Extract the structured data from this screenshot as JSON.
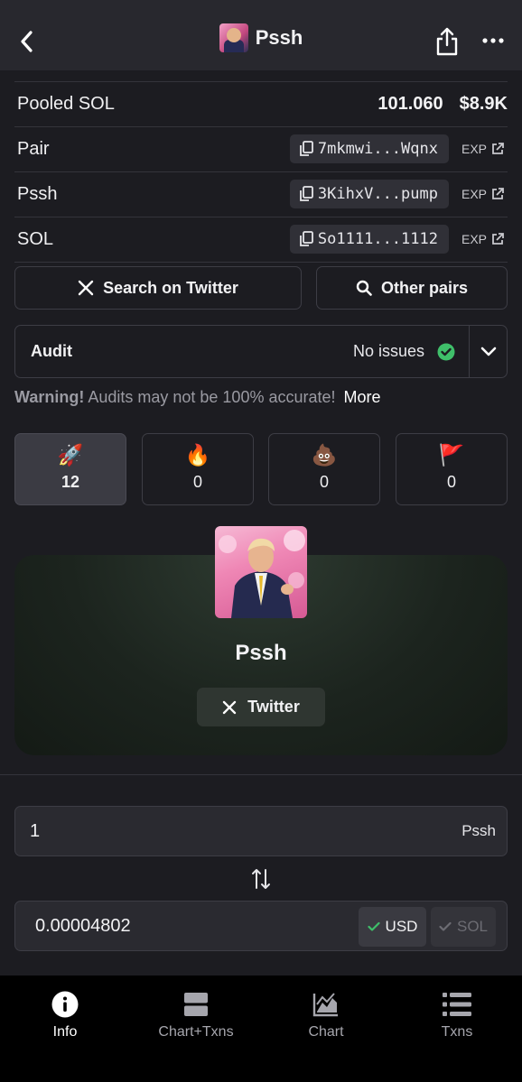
{
  "header": {
    "title": "Pssh"
  },
  "pooled": {
    "label": "Pooled SOL",
    "amount": "101.060",
    "usd": "$8.9K"
  },
  "rows": [
    {
      "label": "Pair",
      "address": "7mkmwi...Wqnx",
      "exp": "EXP"
    },
    {
      "label": "Pssh",
      "address": "3KihxV...pump",
      "exp": "EXP"
    },
    {
      "label": "SOL",
      "address": "So1111...1112",
      "exp": "EXP"
    }
  ],
  "actions": {
    "twitter_search": "Search on Twitter",
    "other_pairs": "Other pairs"
  },
  "audit": {
    "label": "Audit",
    "status": "No issues"
  },
  "warning": {
    "prefix": "Warning!",
    "text": " Audits may not be 100% accurate!",
    "more": "More"
  },
  "reactions": [
    {
      "emoji": "🚀",
      "count": "12"
    },
    {
      "emoji": "🔥",
      "count": "0"
    },
    {
      "emoji": "💩",
      "count": "0"
    },
    {
      "emoji": "🚩",
      "count": "0"
    }
  ],
  "token": {
    "name": "Pssh",
    "twitter_label": "Twitter"
  },
  "converter": {
    "token_amount": "1",
    "token_unit": "Pssh",
    "quote_amount": "0.00004802",
    "usd_label": "USD",
    "sol_label": "SOL"
  },
  "nav": [
    {
      "label": "Info",
      "icon": "info-icon"
    },
    {
      "label": "Chart+Txns",
      "icon": "chart-txns-icon"
    },
    {
      "label": "Chart",
      "icon": "chart-icon"
    },
    {
      "label": "Txns",
      "icon": "list-icon"
    }
  ],
  "colors": {
    "background": "#1c1c21",
    "header": "#28282e",
    "success": "#3fbf6a",
    "card": "#1c241e"
  }
}
